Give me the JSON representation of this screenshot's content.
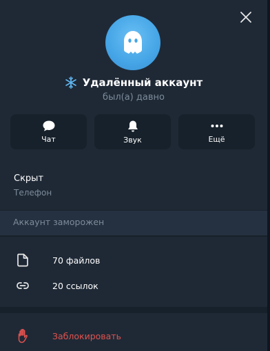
{
  "profile": {
    "name": "Удалённый аккаунт",
    "status": "был(а) давно"
  },
  "actions": [
    {
      "label": "Чат",
      "icon": "chat-bubble-icon"
    },
    {
      "label": "Звук",
      "icon": "bell-icon"
    },
    {
      "label": "Ещё",
      "icon": "more-dots-icon"
    }
  ],
  "info": {
    "value": "Скрыт",
    "label": "Телефон"
  },
  "notice": "Аккаунт заморожен",
  "media": [
    {
      "label": "70 файлов",
      "icon": "file-icon"
    },
    {
      "label": "20 ссылок",
      "icon": "link-icon"
    }
  ],
  "block": {
    "label": "Заблокировать",
    "icon": "hand-stop-icon"
  },
  "colors": {
    "background": "#17212b",
    "panel": "#1f2936",
    "accent": "#45a5e6",
    "danger": "#e0524f",
    "muted": "#7d8b99"
  }
}
